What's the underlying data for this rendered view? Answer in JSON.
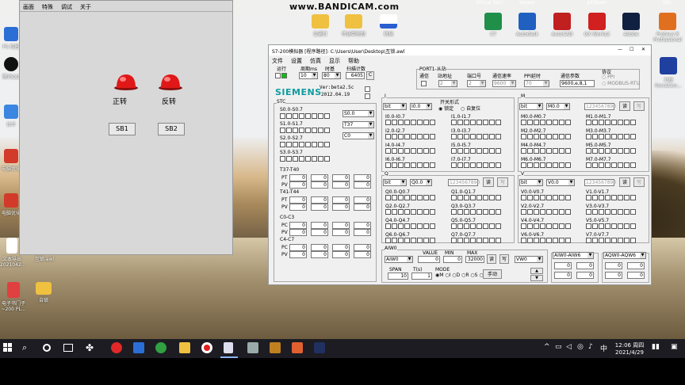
{
  "watermark": "www.BANDICAM.com",
  "desktop_icons": [
    {
      "label": "PS 校园",
      "color": "#2b6fd6"
    },
    {
      "label": "腾讯QQ",
      "color": "#111111"
    },
    {
      "label": "台计",
      "color": "#3a86e0"
    },
    {
      "label": "电脑优化",
      "color": "#d23a2a"
    },
    {
      "label": "电脑优化",
      "color": "#d23a2a"
    },
    {
      "label": "文本导出 2021042...",
      "color": "#ffffff"
    },
    {
      "label": "互锁.awl",
      "color": "#ffffff"
    },
    {
      "label": "电子书门子 ~200 PL...",
      "color": "#e04040"
    },
    {
      "label": "自锁",
      "color": "#f0c040"
    },
    {
      "label": "交通灯",
      "color": "#f0c040"
    },
    {
      "label": "传送带控制",
      "color": "#f0c040"
    },
    {
      "label": "机械",
      "color": "#2b5fd0"
    },
    {
      "label": "CT",
      "color": "#1f8f4a"
    },
    {
      "label": "Autodesk",
      "color": "#2060c0"
    },
    {
      "label": "AutoCAD",
      "color": "#c02020"
    },
    {
      "label": "GX Works2",
      "color": "#d02020"
    },
    {
      "label": "Adobe",
      "color": "#102040"
    },
    {
      "label": "Proteus 8 Professional",
      "color": "#e07020"
    },
    {
      "label": "力控",
      "color": "#2040a0"
    },
    {
      "label": "ForceCon...",
      "color": "#2040a0"
    }
  ],
  "top_icon_labels": [
    "Virtual Seri...",
    "Viewer",
    "a4Sheet",
    "360"
  ],
  "left_window": {
    "menu": [
      "画面",
      "特殊",
      "调试",
      "关于"
    ],
    "lamp1_label": "正转",
    "lamp2_label": "反转",
    "button1": "SB1",
    "button2": "SB2"
  },
  "sim": {
    "title": "S7-200模拟器 [程序路径]: C:\\Users\\User\\Desktop\\互锁.awl",
    "menu": [
      "文件",
      "设置",
      "仿真",
      "显示",
      "帮助"
    ],
    "run_label": "运行",
    "cycle_label": "周期ms",
    "cycle_value": "10",
    "timebase_label": "时基",
    "timebase_value": "80",
    "scan_label": "扫描计数",
    "scan_value": "6405",
    "scan_btn": "C",
    "port_group": "PORT1-从站",
    "comm_label": "通信",
    "station_label": "站地址",
    "station_value": "2",
    "port_label": "端口号",
    "port_value": "2",
    "baud_label": "通信速率",
    "baud_value": "9600",
    "ppi_label": "PPI延时",
    "ppi_value": "70",
    "param_label": "通信参数",
    "param_value": "9600,e,8,1",
    "protocol_label": "协议",
    "protocol_ppi": "PPI",
    "protocol_modbus": "MODBUS-RTU",
    "brand": "SIEMENS",
    "version": "Ver:beta2.5c",
    "date": "2012.04.19",
    "stc_label": "STC",
    "stc_rows": [
      "S0.0-S0.7",
      "S1.0-S1.7",
      "S2.0-S2.7",
      "S3.0-S3.7"
    ],
    "stc_sel1": "S0.0",
    "stc_sel2": "T37",
    "stc_sel3": "C0",
    "timer_groups": [
      "T37-T40",
      "T41-T44"
    ],
    "counter_groups": [
      "C0-C3",
      "C4-C7"
    ],
    "pt_label": "PT",
    "pv_label": "PV",
    "pc_label": "PC",
    "zero": "0",
    "i_label": "I",
    "switch_form": "开关形式",
    "lock_label": "锁定",
    "reset_label": "自复位",
    "i_type": "bit",
    "i_sel": "I0.0",
    "i_rows": [
      "I0.0-I0.7",
      "I1.0-I1.7",
      "I2.0-I2.7",
      "I3.0-I3.7",
      "I4.0-I4.7",
      "I5.0-I5.7",
      "I6.0-I6.7",
      "I7.0-I7.7"
    ],
    "m_label": "M",
    "m_type": "bit",
    "m_sel": "M0.0",
    "m_value": "1234567890",
    "m_rows": [
      "M0.0-M0.7",
      "M1.0-M1.7",
      "M2.0-M2.7",
      "M3.0-M3.7",
      "M4.0-M4.7",
      "M5.0-M5.7",
      "M6.0-M6.7",
      "M7.0-M7.7"
    ],
    "q_label": "Q",
    "q_type": "bit",
    "q_sel": "Q0.0",
    "q_value": "1234567890",
    "q_rows": [
      "Q0.0-Q0.7",
      "Q1.0-Q1.7",
      "Q2.0-Q2.7",
      "Q3.0-Q3.7",
      "Q4.0-Q4.7",
      "Q5.0-Q5.7",
      "Q6.0-Q6.7",
      "Q7.0-Q7.7"
    ],
    "v_label": "V",
    "v_type": "bit",
    "v_sel": "V0.0",
    "v_value": "1234567890",
    "v_rows": [
      "V0.0-V0.7",
      "V1.0-V1.7",
      "V2.0-V2.7",
      "V3.0-V3.7",
      "V4.0-V4.7",
      "V5.0-V5.7",
      "V6.0-V6.7",
      "V7.0-V7.7"
    ],
    "read_btn": "读",
    "write_btn": "写",
    "aiw_label": "AIW0",
    "aiw_sel": "AIW0",
    "value_label": "VALUE",
    "value_val": "0",
    "min_label": "MIN",
    "min_val": "0",
    "max_label": "MAX",
    "max_val": "32000",
    "vw_sel": "VW0",
    "span_label": "SPAN",
    "span_val": "10",
    "t_label": "T(s)",
    "t_val": "1",
    "mode_label": "MODE",
    "modes": [
      "M",
      "I",
      "D",
      "R",
      "S",
      "L"
    ],
    "manual_btn": "手动",
    "aiw_range": "AIW0-AIW6",
    "aqw_range": "AQW0-AQW6"
  },
  "taskbar": {
    "time": "12:06 周四",
    "date": "2021/4/29",
    "input_method": "中"
  }
}
